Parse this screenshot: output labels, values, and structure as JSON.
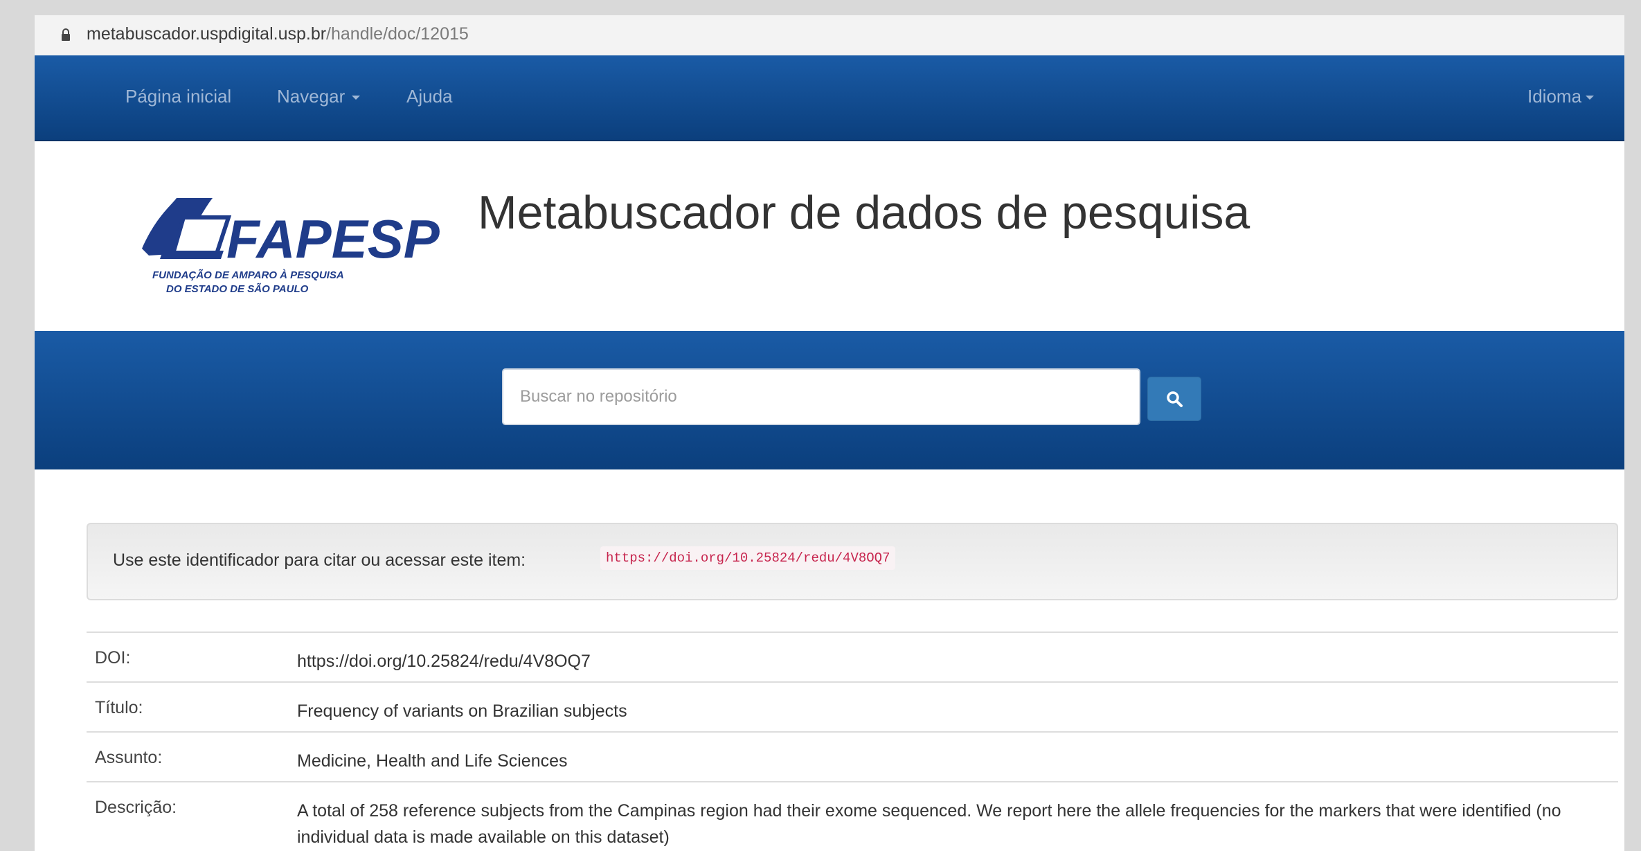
{
  "browser": {
    "url_host": "metabuscador.uspdigital.usp.br",
    "url_path": "/handle/doc/12015"
  },
  "nav": {
    "home": "Página inicial",
    "browse": "Navegar",
    "help": "Ajuda",
    "language": "Idioma"
  },
  "header": {
    "logo_name": "FAPESP",
    "logo_subtitle_1": "FUNDAÇÃO DE AMPARO À PESQUISA",
    "logo_subtitle_2": "DO ESTADO DE SÃO PAULO",
    "title": "Metabuscador de dados de pesquisa"
  },
  "search": {
    "placeholder": "Buscar no repositório",
    "icon": "search-icon"
  },
  "identifier": {
    "label": "Use este identificador para citar ou acessar este item:",
    "value": "https://doi.org/10.25824/redu/4V8OQ7"
  },
  "metadata": [
    {
      "key": "DOI:",
      "value": "https://doi.org/10.25824/redu/4V8OQ7"
    },
    {
      "key": "Título:",
      "value": "Frequency of variants on Brazilian subjects"
    },
    {
      "key": "Assunto:",
      "value": "Medicine, Health and Life Sciences"
    },
    {
      "key": "Descrição:",
      "value": "A total of 258 reference subjects from the Campinas region had their exome sequenced. We report here the allele frequencies for the markers that were identified (no individual data is made available on this dataset)"
    }
  ],
  "colors": {
    "nav_blue": "#1a5ba6",
    "nav_blue_dark": "#0b3f7d",
    "button_blue": "#337ab7",
    "code_red": "#c7254e"
  }
}
